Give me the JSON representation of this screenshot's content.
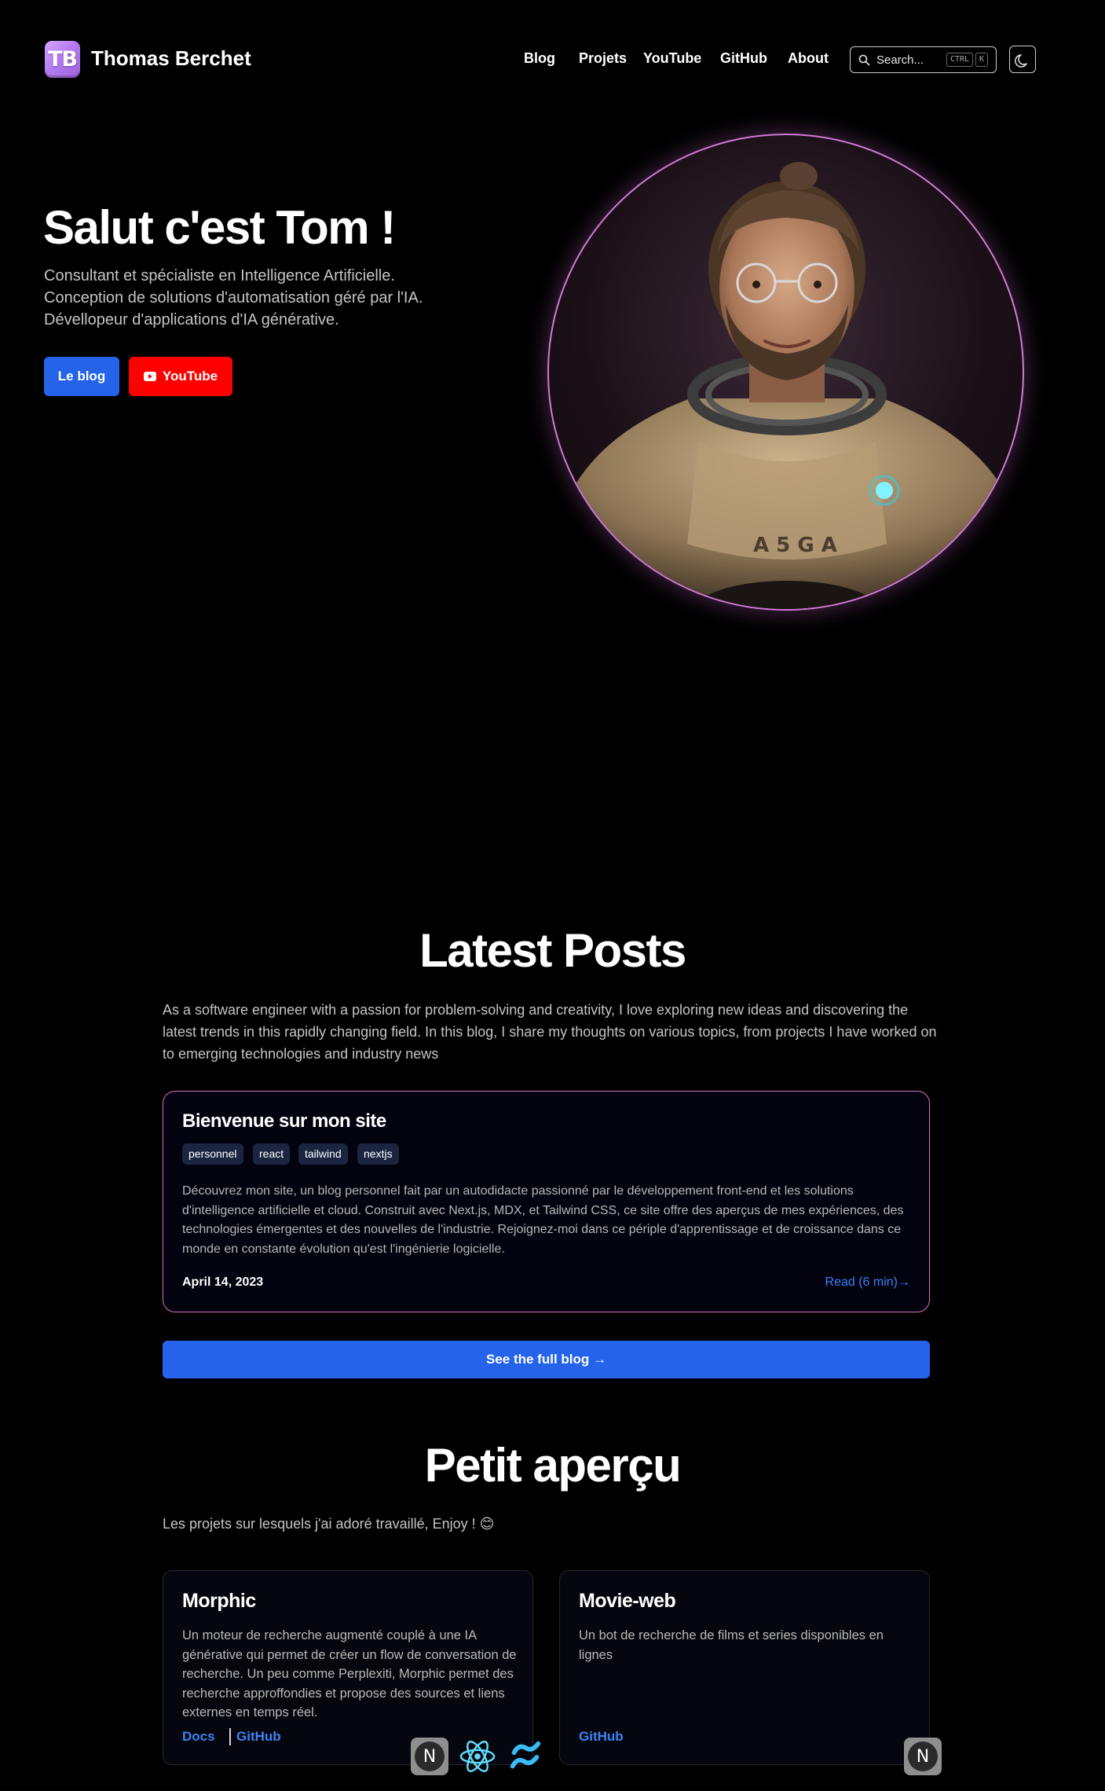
{
  "header": {
    "logo_text": "TB",
    "site_title": "Thomas Berchet",
    "nav": [
      "Blog",
      "Projets",
      "YouTube",
      "GitHub",
      "About"
    ],
    "search_placeholder": "Search...",
    "search_shortcut": [
      "CTRL",
      "K"
    ]
  },
  "hero": {
    "title": "Salut c'est Tom !",
    "lines": [
      "Consultant et spécialiste en Intelligence Artificielle.",
      "Conception de solutions d'automatisation géré par l'IA.",
      "Dévellopeur d'applications d'IA générative."
    ],
    "blog_button": "Le blog",
    "youtube_button": "YouTube"
  },
  "latest_posts": {
    "title": "Latest Posts",
    "intro": "As a software engineer with a passion for problem-solving and creativity, I love exploring new ideas and discovering the latest trends in this rapidly changing field. In this blog, I share my thoughts on various topics, from projects I have worked on to emerging technologies and industry news",
    "posts": [
      {
        "title": "Bienvenue sur mon site",
        "tags": [
          "personnel",
          "react",
          "tailwind",
          "nextjs"
        ],
        "summary": "Découvrez mon site, un blog personnel fait par un autodidacte passionné par le développement front-end et les solutions d'intelligence artificielle et cloud. Construit avec Next.js, MDX, et Tailwind CSS, ce site offre des aperçus de mes expériences, des technologies émergentes et des nouvelles de l'industrie. Rejoignez-moi dans ce périple d'apprentissage et de croissance dans ce monde en constante évolution qu'est l'ingénierie logicielle.",
        "date": "April 14, 2023",
        "read_label": "Read (6 min)→"
      }
    ],
    "full_blog_button": "See the full blog →"
  },
  "projects": {
    "title": "Petit aperçu",
    "intro": "Les projets sur lesquels j'ai adoré travaillé, Enjoy ! 😊",
    "items": [
      {
        "name": "Morphic",
        "description": "Un moteur de recherche augmenté couplé à une IA générative qui permet de créer un flow de conversation de recherche. Un peu comme Perplexiti, Morphic permet des recherche approffondies et propose des sources et liens externes en temps réel.",
        "links": [
          "Docs",
          "GitHub"
        ]
      },
      {
        "name": "Movie-web",
        "description": "Un bot de recherche de films et series disponibles en lignes",
        "links": [
          "GitHub"
        ]
      }
    ],
    "tech_icons": [
      "nextjs-icon",
      "react-icon",
      "tailwind-icon",
      "nextjs-icon"
    ]
  },
  "colors": {
    "accent": "#2563eb",
    "youtube": "#ff0000",
    "card_border": "#d774b8",
    "link": "#3b82f6"
  }
}
